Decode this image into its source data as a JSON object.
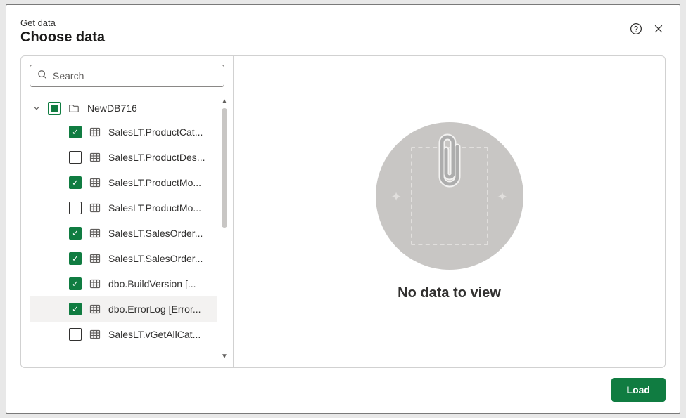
{
  "header": {
    "overline": "Get data",
    "title": "Choose data"
  },
  "search": {
    "placeholder": "Search",
    "value": ""
  },
  "database": {
    "name": "NewDB716",
    "expanded": true,
    "checkbox": "indeterminate"
  },
  "tables": [
    {
      "label": "SalesLT.ProductCat...",
      "checked": true,
      "selected": false
    },
    {
      "label": "SalesLT.ProductDes...",
      "checked": false,
      "selected": false
    },
    {
      "label": "SalesLT.ProductMo...",
      "checked": true,
      "selected": false
    },
    {
      "label": "SalesLT.ProductMo...",
      "checked": false,
      "selected": false
    },
    {
      "label": "SalesLT.SalesOrder...",
      "checked": true,
      "selected": false
    },
    {
      "label": "SalesLT.SalesOrder...",
      "checked": true,
      "selected": false
    },
    {
      "label": "dbo.BuildVersion [...",
      "checked": true,
      "selected": false
    },
    {
      "label": "dbo.ErrorLog [Error...",
      "checked": true,
      "selected": true
    },
    {
      "label": "SalesLT.vGetAllCat...",
      "checked": false,
      "selected": false
    }
  ],
  "preview": {
    "empty_message": "No data to view"
  },
  "footer": {
    "load_label": "Load"
  },
  "icons": {
    "help": "help-icon",
    "close": "close-icon",
    "search": "search-icon",
    "chevron": "chevron-down-icon",
    "folder": "folder-icon",
    "table": "table-icon",
    "clip": "paperclip-icon"
  },
  "colors": {
    "accent": "#107c41"
  }
}
